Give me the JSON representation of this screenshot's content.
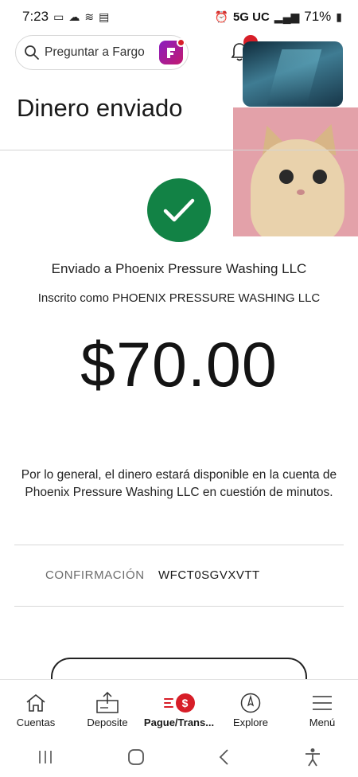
{
  "status_bar": {
    "time": "7:23",
    "network": "5G UC",
    "battery": "71%"
  },
  "search": {
    "placeholder": "Preguntar a Fargo"
  },
  "page": {
    "title": "Dinero enviado"
  },
  "confirmation_screen": {
    "sent_to": "Enviado a Phoenix Pressure Washing LLC",
    "enrolled_as": "Inscrito como PHOENIX PRESSURE WASHING LLC",
    "amount": "$70.00",
    "availability_note": "Por lo general, el dinero estará disponible en la cuenta de Phoenix Pressure Washing LLC en cuestión de minutos.",
    "confirmation_label": "CONFIRMACIÓN",
    "confirmation_value": "WFCT0SGVXVTT"
  },
  "bottom_nav": {
    "items": [
      {
        "label": "Cuentas",
        "icon": "home-icon"
      },
      {
        "label": "Deposite",
        "icon": "deposit-icon"
      },
      {
        "label": "Pague/Trans...",
        "icon": "pay-transfer-icon",
        "active": true
      },
      {
        "label": "Explore",
        "icon": "compass-icon"
      },
      {
        "label": "Menú",
        "icon": "menu-icon"
      }
    ]
  },
  "colors": {
    "success_green": "#128245",
    "brand_red": "#d71e28",
    "fargo_purple": "#8a1cc1"
  }
}
